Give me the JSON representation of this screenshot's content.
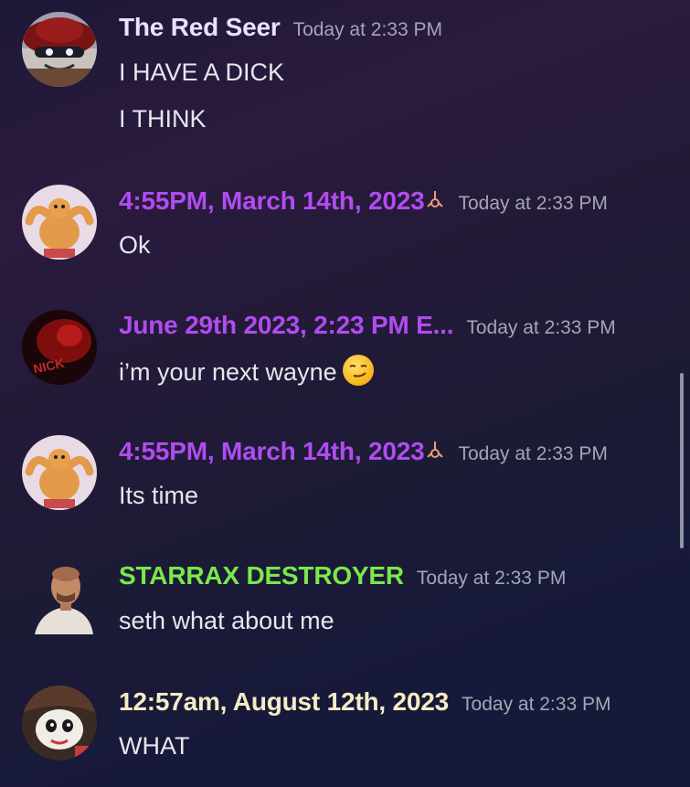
{
  "colors": {
    "timestamp": "#a3a6b4",
    "text": "#e6e7ee",
    "purple_role": "#b04cf0",
    "green_role": "#7ae84a",
    "cream_role": "#f5ecc2",
    "lavender_role": "#e6e2ff"
  },
  "messages": [
    {
      "author": "The Red Seer",
      "timestamp": "Today at 2:33 PM",
      "lines": [
        "I HAVE A DICK",
        "I THINK"
      ],
      "avatar_icon": "red-hat-character-avatar"
    },
    {
      "author": "4:55PM, March 14th, 2023",
      "timestamp": "Today at 2:33 PM",
      "lines": [
        "Ok"
      ],
      "avatar_icon": "muscle-cat-avatar",
      "badge_icon": "hook-badge-icon"
    },
    {
      "author": "June 29th 2023, 2:23 PM E...",
      "timestamp": "Today at 2:33 PM",
      "lines": [
        "i’m your next wayne"
      ],
      "avatar_icon": "dark-red-nick-avatar",
      "avatar_text": "NICK",
      "emoji": "smirking-face-emoji"
    },
    {
      "author": "4:55PM, March 14th, 2023",
      "timestamp": "Today at 2:33 PM",
      "lines": [
        "Its time"
      ],
      "avatar_icon": "muscle-cat-avatar",
      "badge_icon": "hook-badge-icon"
    },
    {
      "author": "STARRAX DESTROYER",
      "timestamp": "Today at 2:33 PM",
      "lines": [
        "seth what about me"
      ],
      "avatar_icon": "bald-man-avatar"
    },
    {
      "author": "12:57am, August 12th, 2023",
      "timestamp": "Today at 2:33 PM",
      "lines": [
        "WHAT"
      ],
      "avatar_icon": "masked-character-avatar"
    }
  ]
}
